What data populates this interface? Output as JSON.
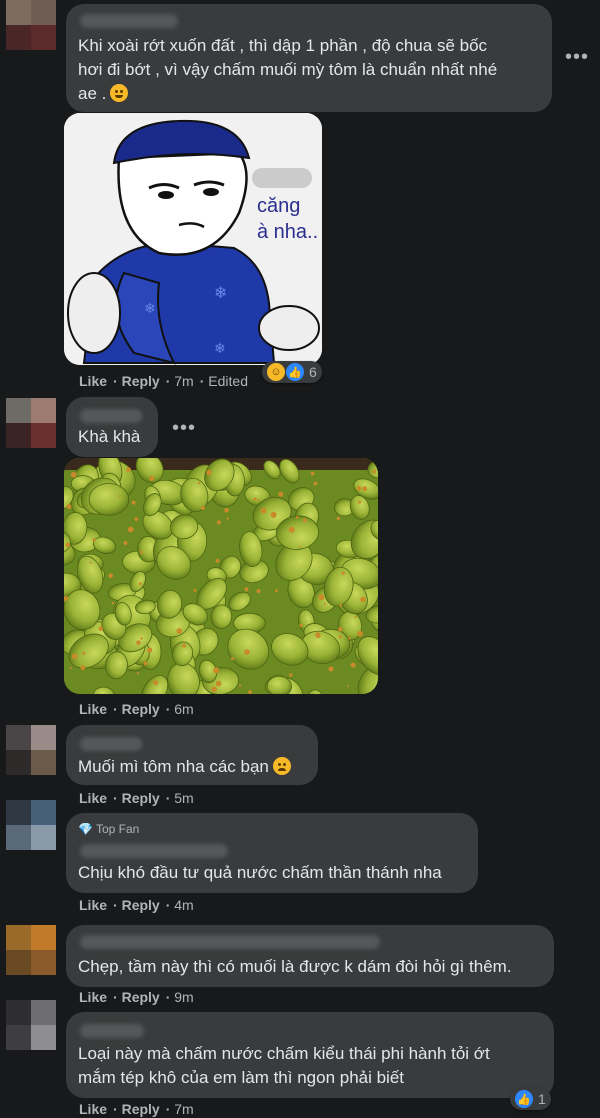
{
  "comments": [
    {
      "text_lines": [
        "Khi xoài rớt xuốn đất , thì dập 1 phần , độ chua sẽ bốc",
        "hơi đi bớt , vì vậy chấm muối mỳ tôm là chuẩn nhất nhé",
        "ae ."
      ],
      "sticker_caption": [
        "căng",
        "à nha.."
      ],
      "like": "Like",
      "reply": "Reply",
      "time": "7m",
      "edited": "Edited",
      "reaction_count": "6"
    },
    {
      "text": "Khà khà",
      "like": "Like",
      "reply": "Reply",
      "time": "6m"
    },
    {
      "text": "Muối mì tôm nha các bạn",
      "like": "Like",
      "reply": "Reply",
      "time": "5m"
    },
    {
      "badge": "Top Fan",
      "text": "Chịu khó đầu tư quả nước chấm thần thánh nha",
      "like": "Like",
      "reply": "Reply",
      "time": "4m"
    },
    {
      "text": "Chẹp, tầm này thì có muối là được k dám đòi hỏi gì thêm.",
      "like": "Like",
      "reply": "Reply",
      "time": "9m"
    },
    {
      "text_lines": [
        "Loại này mà chấm nước chấm kiểu thái phi hành tỏi ớt",
        "mắm tép khô của em làm thì ngon phải biết"
      ],
      "like": "Like",
      "reply": "Reply",
      "time": "7m",
      "reaction_count": "1"
    }
  ],
  "colors": {
    "background": "#18191a",
    "bubble": "#3a3b3c",
    "text": "#e4e6eb",
    "muted": "#b0b3b8",
    "like_blue": "#2d88ff"
  },
  "icons": [
    "more-options-icon",
    "laughing-emoji-icon",
    "like-reaction-icon",
    "haha-reaction-icon",
    "top-fan-diamond-icon",
    "sad-emoji-icon"
  ]
}
